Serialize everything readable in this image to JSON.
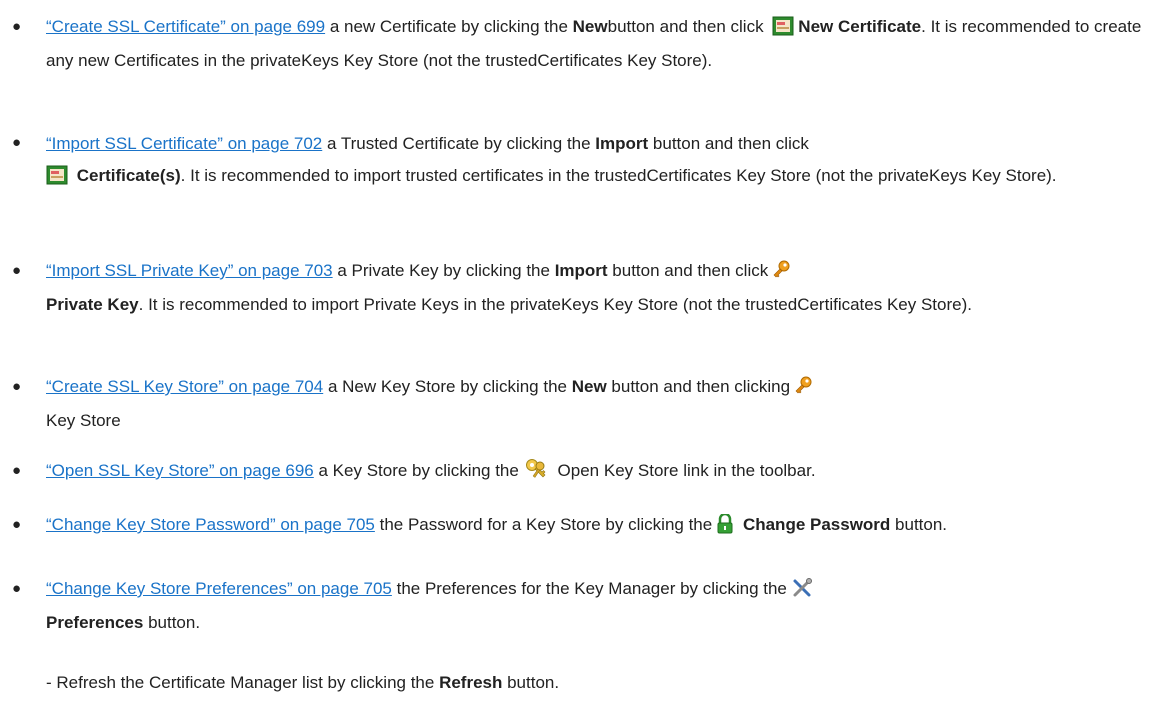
{
  "items": [
    {
      "link": "“Create SSL Certificate” on page 699",
      "text1": " a new Certificate by clicking the ",
      "bold1": "New",
      "text2": "button and then click ",
      "icon": "certificate-icon",
      "bold2": "New Certificate",
      "text3": ". It is recommended to create any new Certificates in the privateKeys Key Store (not the trustedCertificates Key Store)."
    },
    {
      "link": "“Import SSL Certificate” on page 702",
      "text1": " a Trusted Certificate by clicking the ",
      "bold1": "Import",
      "text2": " button and then click",
      "icon": "certificate-icon",
      "bold2": "Certificate(s)",
      "text3": ". It is recommended to import trusted certificates in the trustedCertificates Key Store (not the privateKeys Key Store)."
    },
    {
      "link": "“Import SSL Private Key” on page 703",
      "text1": " a Private Key by clicking the ",
      "bold1": "Import",
      "text2": " button and then click",
      "icon": "key-icon",
      "bold2": "Private Key",
      "text3": ". It is recommended to import Private Keys in the privateKeys Key Store (not the trustedCertificates Key Store)."
    },
    {
      "link": "“Create SSL Key Store” on page 704",
      "text1": " a New Key Store by clicking the ",
      "bold1": "New",
      "text2": " button and then clicking",
      "icon": "key-icon",
      "text3": "Key Store"
    },
    {
      "link": "“Open SSL Key Store” on page 696",
      "text1": " a Key Store by clicking the",
      "icon": "keys-icon",
      "text3": " Open Key Store link in the toolbar."
    },
    {
      "link": "“Change Key Store Password” on page 705",
      "text1": " the Password for a Key Store by clicking the",
      "icon": "lock-icon",
      "bold2": "Change Password",
      "text3": " button."
    },
    {
      "link": "“Change Key Store Preferences” on page 705",
      "text1": " the Preferences for the Key Manager by clicking the",
      "icon": "tools-icon",
      "bold2": "Preferences",
      "text3": " button."
    }
  ],
  "sub_item": {
    "prefix": "- Refresh the Certificate Manager list by clicking the ",
    "bold": "Refresh",
    "suffix": " button."
  },
  "colors": {
    "link": "#1a73c8",
    "text": "#222222"
  }
}
